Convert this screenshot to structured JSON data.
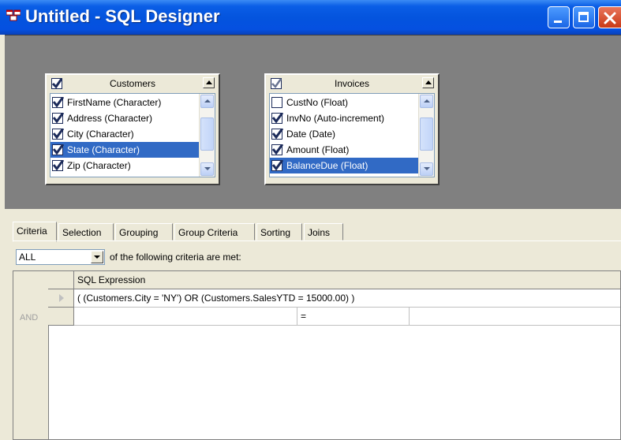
{
  "window": {
    "title": "Untitled - SQL Designer"
  },
  "tables": [
    {
      "name": "Customers",
      "fields": [
        {
          "label": "FirstName (Character)",
          "checked": true,
          "selected": false
        },
        {
          "label": "Address (Character)",
          "checked": true,
          "selected": false
        },
        {
          "label": "City (Character)",
          "checked": true,
          "selected": false
        },
        {
          "label": "State (Character)",
          "checked": true,
          "selected": true
        },
        {
          "label": "Zip (Character)",
          "checked": true,
          "selected": false
        }
      ]
    },
    {
      "name": "Invoices",
      "fields": [
        {
          "label": "CustNo (Float)",
          "checked": false,
          "selected": false
        },
        {
          "label": "InvNo (Auto-increment)",
          "checked": true,
          "selected": false
        },
        {
          "label": "Date (Date)",
          "checked": true,
          "selected": false
        },
        {
          "label": "Amount (Float)",
          "checked": true,
          "selected": false
        },
        {
          "label": "BalanceDue (Float)",
          "checked": true,
          "selected": true
        }
      ]
    }
  ],
  "tabs": [
    "Criteria",
    "Selection",
    "Grouping",
    "Group Criteria",
    "Sorting",
    "Joins"
  ],
  "criteria": {
    "match_mode": "ALL",
    "suffix": "of the following criteria are met:",
    "column_header": "SQL Expression",
    "expression": "( (Customers.City = 'NY')  OR  (Customers.SalesYTD = 15000.00) )",
    "row2_label": "AND",
    "row2_operator": "="
  },
  "colors": {
    "titlebar": "#0454de",
    "design_bg": "#808080",
    "selection": "#316ac5",
    "face": "#ece9d8"
  }
}
